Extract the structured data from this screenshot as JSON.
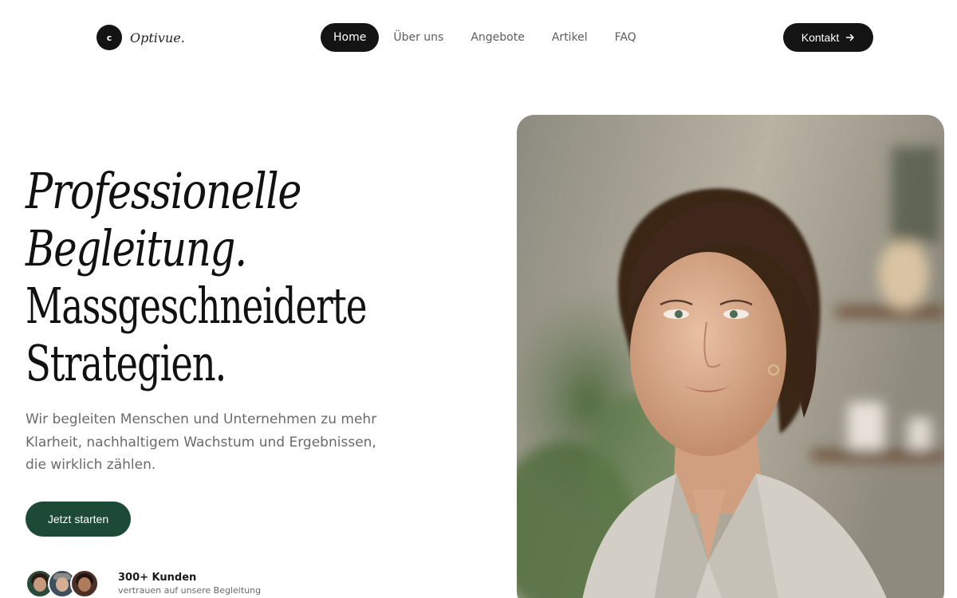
{
  "brand": {
    "mark": "c",
    "name": "Optivue."
  },
  "nav": {
    "items": [
      {
        "label": "Home",
        "active": true
      },
      {
        "label": "Über uns",
        "active": false
      },
      {
        "label": "Angebote",
        "active": false
      },
      {
        "label": "Artikel",
        "active": false
      },
      {
        "label": "FAQ",
        "active": false
      }
    ],
    "cta_label": "Kontakt",
    "cta_icon": "arrow-right-icon"
  },
  "hero": {
    "title_line1": "Professionelle",
    "title_line2": "Begleitung.",
    "title_line3": "Massgeschneiderte",
    "title_line4": "Strategien.",
    "subtitle": "Wir begleiten Menschen und Unternehmen zu mehr Klarheit, nachhaltigem Wachstum und Ergebnissen, die wirklich zählen.",
    "cta_label": "Jetzt starten"
  },
  "social_proof": {
    "count": "300+ Kunden",
    "label": "vertrauen auf unsere Begleitung"
  },
  "colors": {
    "dark": "#141414",
    "accent_green": "#1d4a37",
    "muted_text": "#6a6a6a",
    "background": "#ffffff"
  }
}
